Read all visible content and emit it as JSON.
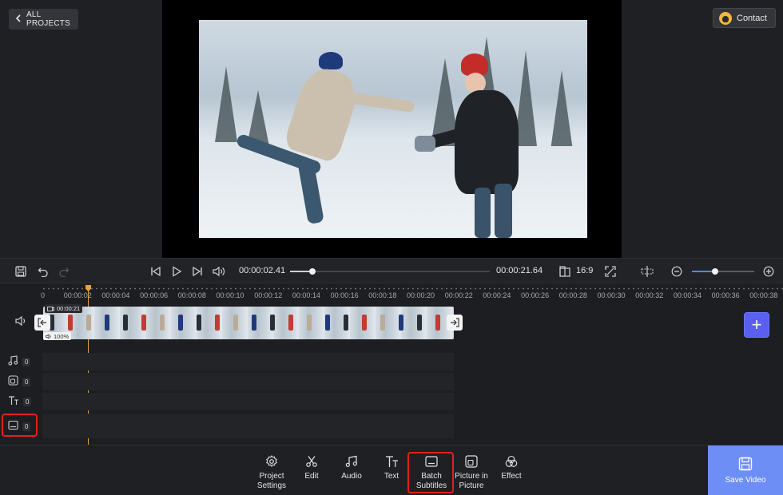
{
  "header": {
    "back_label": "ALL PROJECTS",
    "contact_label": "Contact"
  },
  "player": {
    "current_time": "00:00:02.41",
    "total_time": "00:00:21.64",
    "aspect_ratio": "16:9",
    "progress_fraction": 0.11,
    "zoom_fraction": 0.37
  },
  "ruler": {
    "ticks": [
      "0",
      "00:00:02",
      "00:00:04",
      "00:00:06",
      "00:00:08",
      "00:00:10",
      "00:00:12",
      "00:00:14",
      "00:00:16",
      "00:00:18",
      "00:00:20",
      "00:00:22",
      "00:00:24",
      "00:00:26",
      "00:00:28",
      "00:00:30",
      "00:00:32",
      "00:00:34",
      "00:00:36",
      "00:00:38"
    ]
  },
  "timeline": {
    "clip_duration": "00:00:21",
    "clip_volume": "100%",
    "tracks": [
      {
        "name": "audio",
        "icon": "music-note-icon",
        "count": "0"
      },
      {
        "name": "picture-in-picture",
        "icon": "pip-icon",
        "count": "0"
      },
      {
        "name": "text",
        "icon": "text-icon",
        "count": "0"
      },
      {
        "name": "subtitles",
        "icon": "subtitle-icon",
        "count": "0"
      }
    ],
    "add_label": "+"
  },
  "tools": [
    {
      "label_line1": "Project",
      "label_line2": "Settings",
      "icon": "gear-icon"
    },
    {
      "label_line1": "Edit",
      "label_line2": "",
      "icon": "scissors-icon"
    },
    {
      "label_line1": "Audio",
      "label_line2": "",
      "icon": "music-note-icon"
    },
    {
      "label_line1": "Text",
      "label_line2": "",
      "icon": "text-icon"
    },
    {
      "label_line1": "Batch",
      "label_line2": "Subtitles",
      "icon": "subtitle-icon"
    },
    {
      "label_line1": "Picture in",
      "label_line2": "Picture",
      "icon": "pip-icon"
    },
    {
      "label_line1": "Effect",
      "label_line2": "",
      "icon": "effect-icon"
    }
  ],
  "save_label": "Save Video",
  "colors": {
    "accent": "#6d8ff5",
    "add_button": "#5a5ff0",
    "playhead": "#e8a13a",
    "highlight": "#e02020"
  }
}
